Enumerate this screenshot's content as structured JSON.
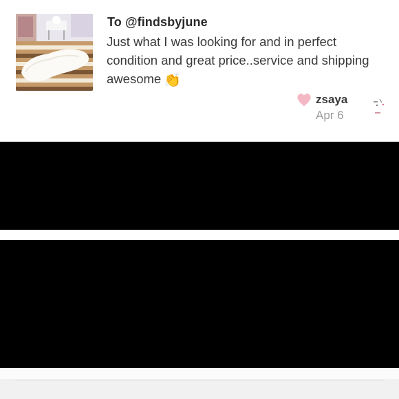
{
  "review": {
    "recipient": "To @findsbyjune",
    "comment": "Just what I was looking for and in perfect condition and great price..service and shipping awesome",
    "emoji": "👏",
    "author": "zsaya",
    "date": "Apr 6"
  },
  "colors": {
    "heart": "#f4b8c4",
    "text_primary": "#2a2a2a",
    "text_muted": "#9a9a9a",
    "black_band": "#000000"
  },
  "icons": {
    "heart": "heart-icon",
    "sparkle": "sparkle-icon",
    "clap": "clapping-hands-emoji"
  }
}
